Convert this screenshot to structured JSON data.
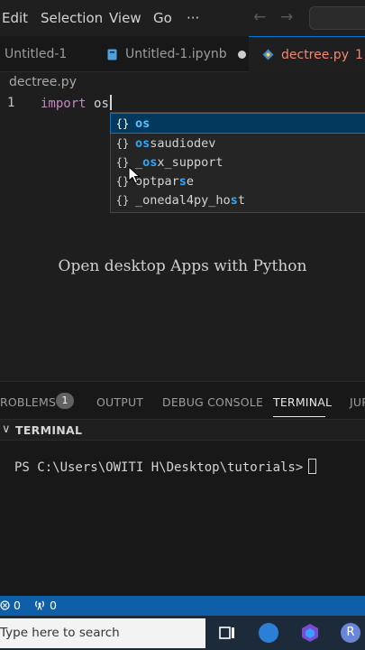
{
  "menu": {
    "edit": "Edit",
    "selection": "Selection",
    "view": "View",
    "go": "Go",
    "more": "···"
  },
  "tabs": [
    {
      "label": "Untitled-1"
    },
    {
      "label": "Untitled-1.ipynb"
    },
    {
      "label": "dectree.py",
      "problems": "1"
    }
  ],
  "breadcrumb": "dectree.py",
  "editor": {
    "line_number": "1",
    "keyword": "import",
    "typed": "os"
  },
  "suggestions": [
    {
      "icon": "{}",
      "pre": "",
      "match": "os",
      "post": ""
    },
    {
      "icon": "{}",
      "pre": "",
      "match": "os",
      "post": "saudiodev"
    },
    {
      "icon": "{}",
      "pre": "_",
      "match": "os",
      "post": "x_support"
    },
    {
      "icon": "{}",
      "pre": "optpar",
      "match": "s",
      "post": "e"
    },
    {
      "icon": "{}",
      "pre": "_onedal4py_ho",
      "match": "s",
      "post": "t"
    }
  ],
  "caption": "Open desktop Apps with Python",
  "panel": {
    "problems": "ROBLEMS",
    "problems_count": "1",
    "output": "OUTPUT",
    "debug_console": "DEBUG CONSOLE",
    "terminal": "TERMINAL",
    "jupyter": "JUP",
    "terminal_header": "TERMINAL",
    "prompt": "PS C:\\Users\\OWITI H\\Desktop\\tutorials>"
  },
  "status": {
    "errors": "0",
    "ports": "0"
  },
  "taskbar": {
    "search_placeholder": "Type here to search"
  },
  "colors": {
    "accent": "#0078d4",
    "statusbar": "#0f5fa8",
    "keyword": "#c586c0",
    "match": "#2aaaff"
  }
}
